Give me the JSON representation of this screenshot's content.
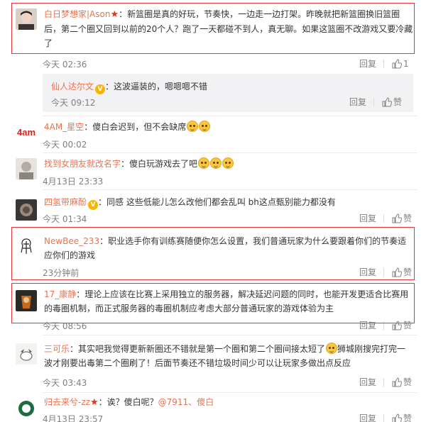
{
  "labels": {
    "reply": "回复",
    "like": "赞"
  },
  "comments": [
    {
      "name": "白日梦想家|Ason",
      "text": "：新篮圈是真的好玩，节奏快，一边走一边打架。昨晚就把新篮圈换旧篮圈后，第二个圈又回到以前的20个人？跑了一天都碰不到人，真无聊。如果这篮圈不改游戏又要冷藏了",
      "time": "今天 02:36",
      "likes": "1"
    },
    {
      "name": "仙人达尔文",
      "text": "：这波逼装的，嗯嗯嗯不错",
      "time": "今天 09:12"
    },
    {
      "name": "4AM_星空",
      "text": "：傻白会迟到，但不会缺席",
      "time": "今天 00:02"
    },
    {
      "name": "找到女朋友就改名字",
      "text": "：傻白玩游戏去了吧",
      "time": "4月13日 23:33"
    },
    {
      "name": "四氢带麻酚",
      "text": "：同感 这些低能儿怎么改他们都会乱叫 bh这点甄别能力都没有",
      "time": "今天 01:34"
    },
    {
      "name": "NewBee_233",
      "text": "：职业选手你有训练赛随便你怎么设置，我们普通玩家为什么要跟着你们的节奏适应你们的游戏",
      "time": "23分钟前"
    },
    {
      "name": "17_康静",
      "text": "：理论上应该在比赛上采用独立的服务器，解决延迟问题的同时，也能开发更适合比赛用的毒圈机制，而正式服务器的毒圈机制应考虑大部分普通玩家的游戏体验为主",
      "time": "今天 08:56"
    },
    {
      "name": "三可乐",
      "text_a": "：其实吧我觉得更新新圈还不错就是第一个圈和第二个圈间接太短了",
      "mention": "狮城刚搜完打完一",
      "text_b": "波才刚要出毒第二个圈刷了！后面节奏还不错垃圾时间少可以让玩家多做出点反应",
      "time": "今天 03:43"
    },
    {
      "name": "归去来兮-zz",
      "text": "：诶？傻白呢？",
      "mention": "@7911、傻白",
      "time": "4月13日 23:57"
    }
  ],
  "colors": {
    "name": "#eb7350",
    "text": "#333333",
    "meta": "#808080",
    "highlight": "#e8333a",
    "reply_bg": "#f2f2f5"
  }
}
